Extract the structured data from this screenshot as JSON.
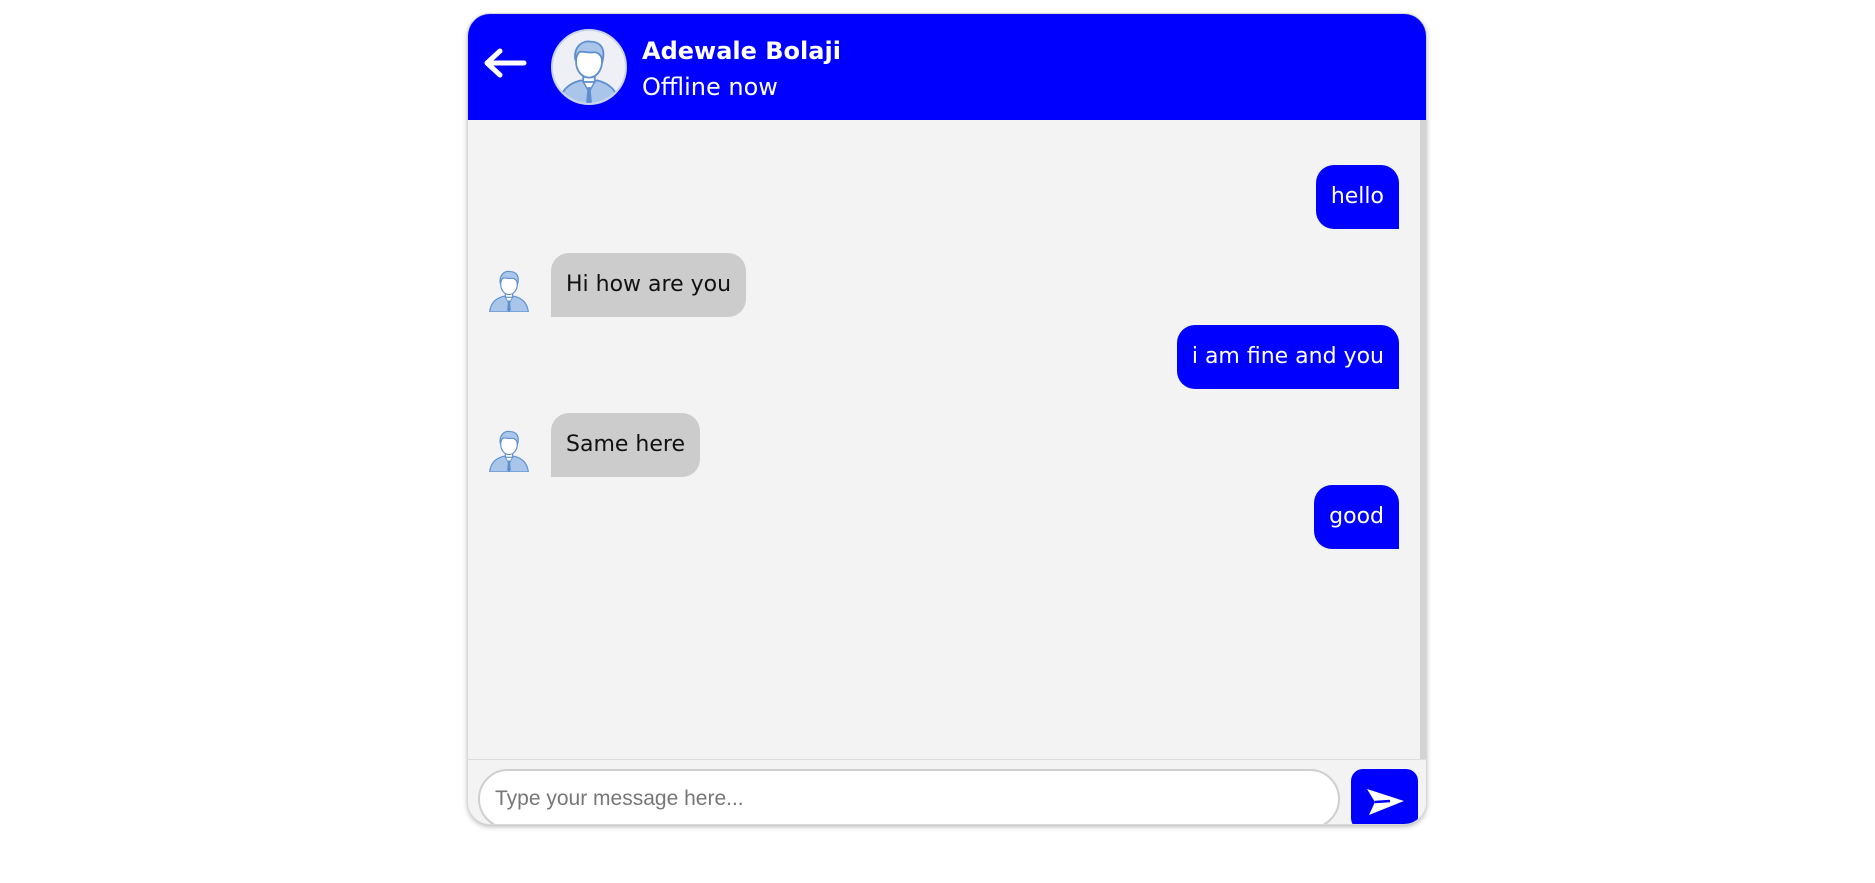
{
  "header": {
    "back_icon": "arrow-left-icon",
    "avatar_icon": "user-avatar-icon",
    "contact_name": "Adewale Bolaji",
    "status": "Offline now"
  },
  "messages": [
    {
      "direction": "outgoing",
      "text": "hello"
    },
    {
      "direction": "incoming",
      "text": "Hi how are you",
      "avatar_icon": "user-avatar-icon"
    },
    {
      "direction": "outgoing",
      "text": "i am fine and you"
    },
    {
      "direction": "incoming",
      "text": "Same here",
      "avatar_icon": "user-avatar-icon"
    },
    {
      "direction": "outgoing",
      "text": "good"
    }
  ],
  "composer": {
    "placeholder": "Type your message here...",
    "value": "",
    "send_icon": "send-icon"
  },
  "colors": {
    "accent": "#0000ff",
    "incoming_bubble": "#cccccc",
    "chat_background": "#f3f3f3"
  }
}
